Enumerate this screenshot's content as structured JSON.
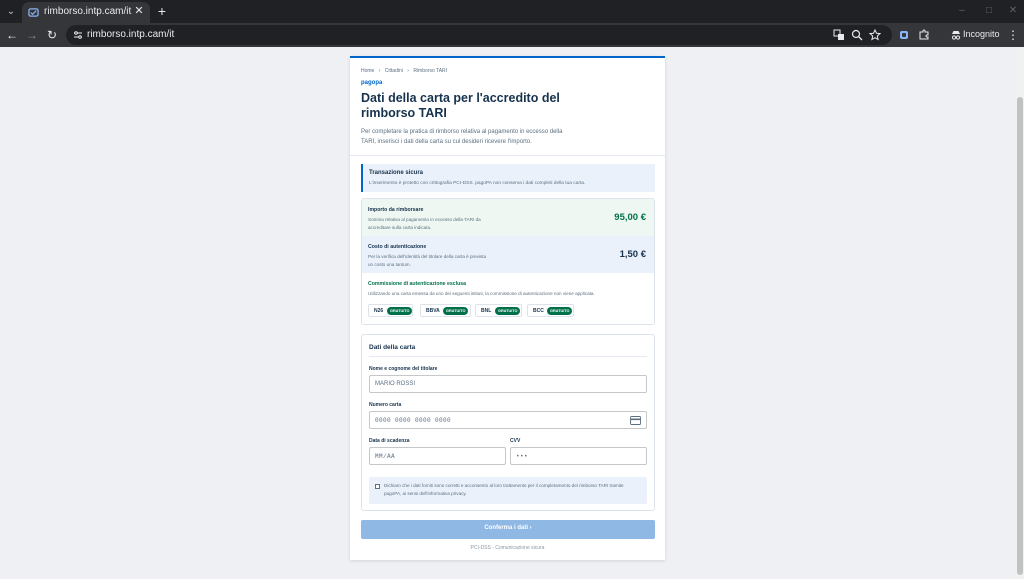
{
  "browser": {
    "tab_title": "rimborso.intp.cam/it",
    "url": "rimborso.intp.cam/it",
    "incognito_label": "Incognito",
    "new_tab": "+",
    "close": "✕",
    "icons": [
      "back-arrow-icon",
      "forward-arrow-icon",
      "reload-icon",
      "site-info-icon",
      "translate-icon",
      "zoom-icon",
      "bookmark-star-icon",
      "extension-icon",
      "puzzle-icon",
      "incognito-icon",
      "menu-kebab-icon"
    ]
  },
  "breadcrumb": [
    "Home",
    "›",
    "Cittadini",
    "›",
    "Rimborso TARI"
  ],
  "brand": "pagopa",
  "title": "Dati della carta per l'accredito del rimborso TARI",
  "intro": "Per completare la pratica di rimborso relativa al pagamento in eccesso della TARI, inserisci i dati della carta su cui desideri ricevere l'importo.",
  "secure": {
    "title": "Transazione sicura",
    "text": "L'inserimento è protetto con crittografia PCI-DSS. pagoPA non conserva i dati completi della tua carta."
  },
  "summary": {
    "refund_label": "Importo da rimborsare",
    "refund_desc": "Somma relativa al pagamento in eccesso della TARI da accreditare sulla carta indicata.",
    "refund_amount": "95,00 €",
    "auth_label": "Costo di autenticazione",
    "auth_desc": "Per la verifica dell'identità del titolare della carta è prevista un costo una tantum.",
    "auth_amount": "1,50 €",
    "commission_title": "Commissione di autenticazione esclusa",
    "commission_desc": "Utilizzando una carta emessa da uno dei seguenti istituti, la commissione di autenticazione non viene applicata.",
    "banks": [
      {
        "name": "N26",
        "badge": "GRATUITO"
      },
      {
        "name": "BBVA",
        "badge": "GRATUITO"
      },
      {
        "name": "BNL",
        "badge": "GRATUITO"
      },
      {
        "name": "BCC",
        "badge": "GRATUITO"
      }
    ]
  },
  "form": {
    "title": "Dati della carta",
    "holder_label": "Nome e cognome del titolare",
    "holder_placeholder": "MARIO ROSSI",
    "number_label": "Numero carta",
    "number_placeholder": "0000 0000 0000 0000",
    "expiry_label": "Data di scadenza",
    "expiry_placeholder": "MM/AA",
    "cvv_label": "CVV",
    "cvv_placeholder": "•••",
    "consent": "Dichiaro che i dati forniti sono corretti e acconsento al loro trattamento per il completamento del rimborso TARI tramite pagoPA, ai sensi dell'informativa privacy."
  },
  "confirm_label": "Conferma i dati  ›",
  "footer_note": "PCI-DSS  ·  Comunicazione sicura",
  "colors": {
    "accent": "#0066cc",
    "success": "#00704a",
    "button_disabled": "#8fb8e5"
  }
}
